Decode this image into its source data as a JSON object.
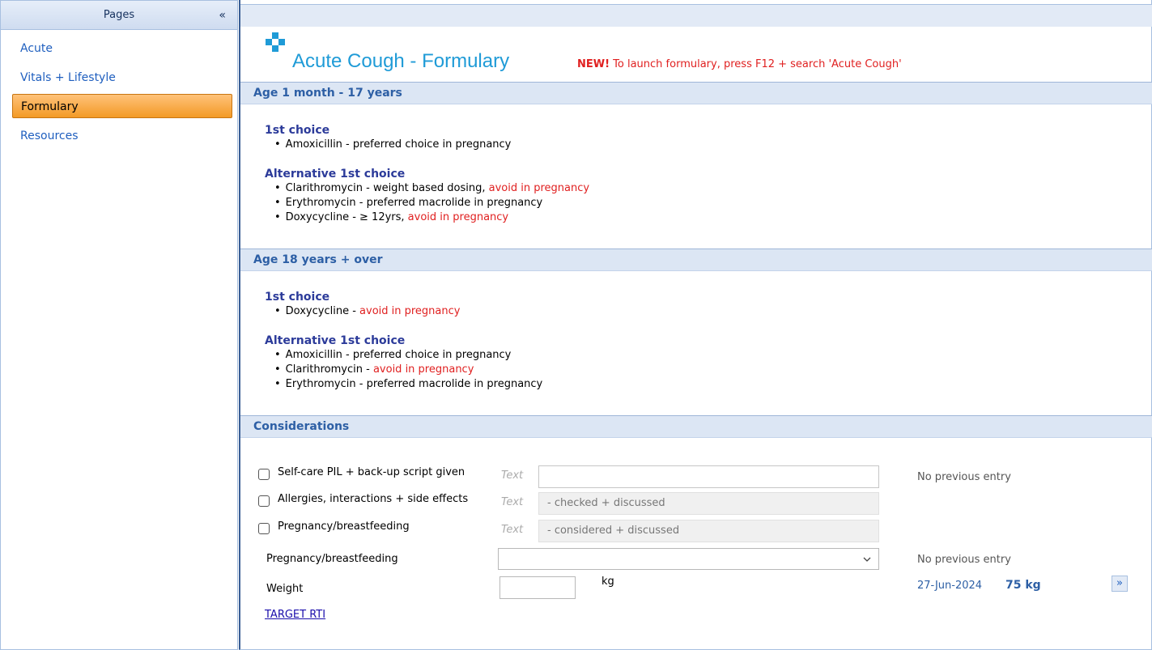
{
  "sidebar": {
    "header": "Pages",
    "collapse_icon": "«",
    "items": [
      {
        "label": "Acute"
      },
      {
        "label": "Vitals + Lifestyle"
      },
      {
        "label": "Formulary",
        "active": true
      },
      {
        "label": "Resources"
      }
    ]
  },
  "main": {
    "title": "Acute Cough - Formulary",
    "notice_new": "NEW!",
    "notice_text": " To launch formulary, press F12 + search 'Acute Cough'",
    "sections": [
      {
        "heading": "Age 1 month - 17 years",
        "groups": [
          {
            "title": "1st choice",
            "items": [
              {
                "text": "Amoxicillin - preferred choice in pregnancy",
                "warn": ""
              }
            ]
          },
          {
            "title": "Alternative 1st choice",
            "items": [
              {
                "text": "Clarithromycin - weight based dosing, ",
                "warn": "avoid in pregnancy"
              },
              {
                "text": "Erythromycin - preferred macrolide in pregnancy",
                "warn": ""
              },
              {
                "text": "Doxycycline - ≥ 12yrs, ",
                "warn": "avoid in pregnancy"
              }
            ]
          }
        ]
      },
      {
        "heading": "Age 18 years + over",
        "groups": [
          {
            "title": "1st choice",
            "items": [
              {
                "text": "Doxycycline - ",
                "warn": "avoid in pregnancy"
              }
            ]
          },
          {
            "title": "Alternative 1st choice",
            "items": [
              {
                "text": "Amoxicillin - preferred choice in pregnancy",
                "warn": ""
              },
              {
                "text": "Clarithromycin - ",
                "warn": "avoid in pregnancy"
              },
              {
                "text": "Erythromycin - preferred macrolide in pregnancy",
                "warn": ""
              }
            ]
          }
        ]
      }
    ],
    "considerations": {
      "heading": "Considerations",
      "rows": [
        {
          "label": "Self-care PIL + back-up script given",
          "text_label": "Text",
          "value": "",
          "previous": "No previous entry"
        },
        {
          "label": "Allergies, interactions + side effects",
          "text_label": "Text",
          "value": "- checked + discussed",
          "previous": ""
        },
        {
          "label": "Pregnancy/breastfeeding",
          "text_label": "Text",
          "value": "- considered + discussed",
          "previous": ""
        }
      ],
      "select_label": "Pregnancy/breastfeeding",
      "select_value": "",
      "select_previous": "No previous entry",
      "weight_label": "Weight",
      "weight_unit": "kg",
      "weight_value": "",
      "weight_prev_date": "27-Jun-2024",
      "weight_prev_value": "75 kg",
      "next_icon": "»",
      "link": "TARGET RTI"
    }
  },
  "colors": {
    "accent": "#2d5fa5",
    "title": "#1f9bd7",
    "warning": "#e02020",
    "active_tab": "#f39a25"
  }
}
